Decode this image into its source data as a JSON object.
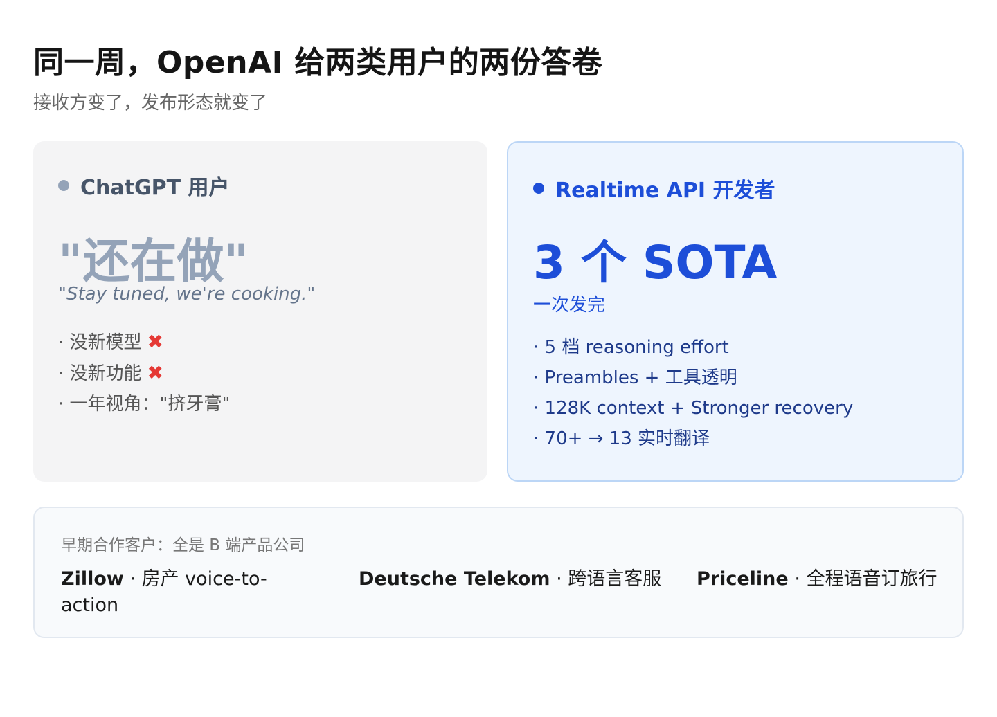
{
  "header": {
    "title": "同一周，OpenAI 给两类用户的两份答卷",
    "subtitle": "接收方变了，发布形态就变了"
  },
  "left_card": {
    "label": "ChatGPT 用户",
    "big_quote": "\"还在做\"",
    "quote_en": "\"Stay tuned, we're cooking.\"",
    "items": [
      {
        "text": "· 没新模型",
        "mark": "✖"
      },
      {
        "text": "· 没新功能",
        "mark": "✖"
      },
      {
        "text": "· 一年视角：\"挤牙膏\""
      }
    ]
  },
  "right_card": {
    "label": "Realtime API 开发者",
    "headline": "3 个 SOTA",
    "subline": "一次发完",
    "items": [
      "· 5 档 reasoning effort",
      "· Preambles + 工具透明",
      "· 128K context + Stronger recovery",
      "· 70+ → 13 实时翻译"
    ]
  },
  "partners": {
    "label": "早期合作客户：全是 B 端产品公司",
    "items": [
      {
        "name": "Zillow",
        "sep": " · ",
        "desc": "房产 voice-to-action"
      },
      {
        "name": "Deutsche Telekom",
        "sep": " · ",
        "desc": "跨语言客服"
      },
      {
        "name": "Priceline",
        "sep": " · ",
        "desc": "全程语音订旅行"
      }
    ]
  },
  "colors": {
    "accent_blue": "#1d4ed8",
    "muted_gray": "#94a3b8",
    "cross_red": "#e53935"
  }
}
